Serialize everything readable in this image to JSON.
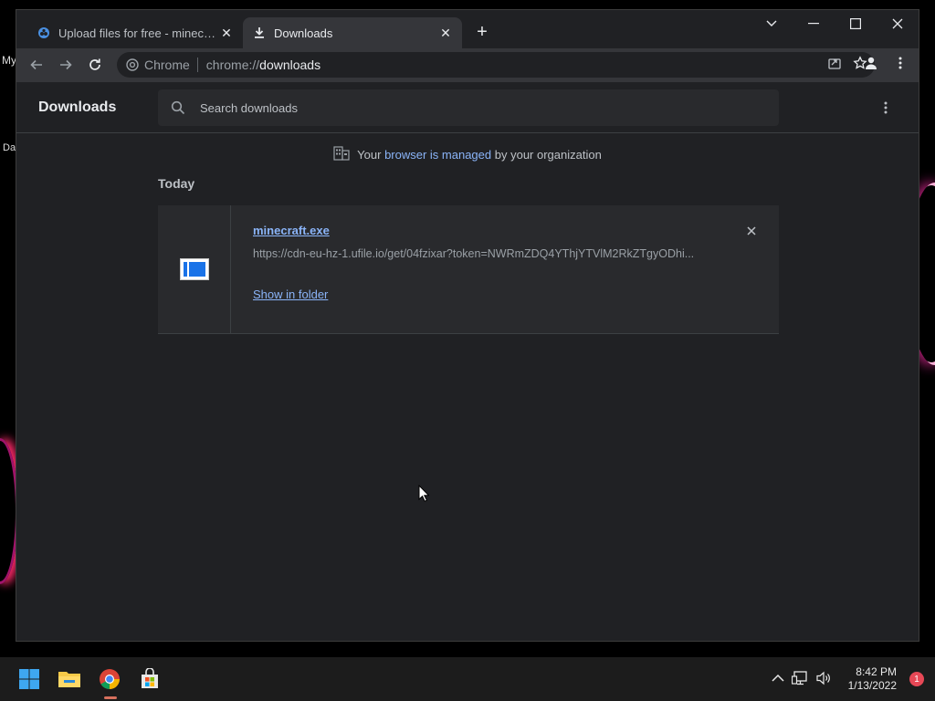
{
  "desktop": {
    "label_my": "My",
    "label_da": "Da"
  },
  "tabs": [
    {
      "title": "Upload files for free - minecraft.exe",
      "close": "✕"
    },
    {
      "title": "Downloads",
      "close": "✕"
    }
  ],
  "new_tab": "+",
  "omnibox": {
    "chip": "Chrome",
    "url_prefix": "chrome://",
    "url_path": "downloads"
  },
  "page": {
    "title": "Downloads",
    "search_placeholder": "Search downloads",
    "managed_prefix": "Your",
    "managed_link": "browser is managed",
    "managed_suffix": "by your organization",
    "section_date": "Today"
  },
  "download": {
    "filename": "minecraft.exe",
    "url": "https://cdn-eu-hz-1.ufile.io/get/04fzixar?token=NWRmZDQ4YThjYTVlM2RkZTgyODhi...",
    "action": "Show in folder"
  },
  "taskbar": {
    "time": "8:42 PM",
    "date": "1/13/2022",
    "notifications": "1"
  },
  "colors": {
    "link": "#8ab4f8",
    "bg": "#202124",
    "card": "#292a2d",
    "accent": "#1a73e8"
  }
}
